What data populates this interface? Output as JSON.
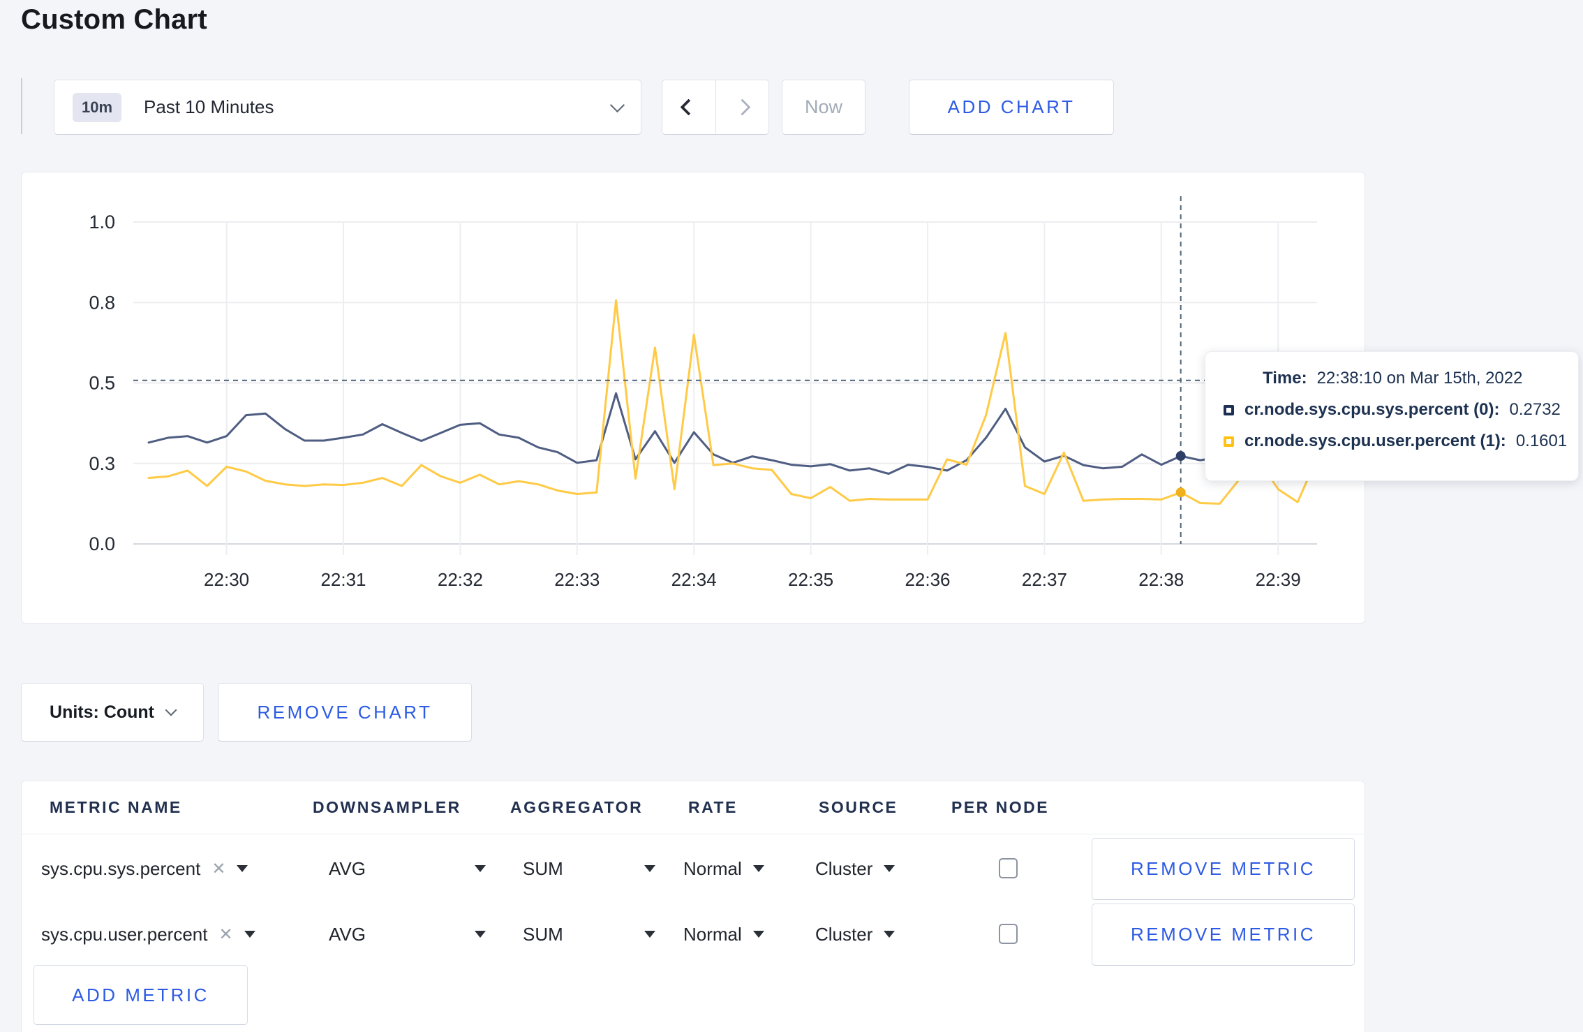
{
  "title": "Custom Chart",
  "toolbar": {
    "range_badge": "10m",
    "range_label": "Past 10 Minutes",
    "now_label": "Now",
    "add_chart_label": "ADD CHART"
  },
  "units": {
    "label": "Units: Count",
    "remove_chart_label": "REMOVE CHART"
  },
  "chart_data": {
    "type": "line",
    "x_start": "22:29:20",
    "x_step_seconds": 10,
    "x_ticks": [
      "22:30",
      "22:31",
      "22:32",
      "22:33",
      "22:34",
      "22:35",
      "22:36",
      "22:37",
      "22:38",
      "22:39"
    ],
    "y_ticks": [
      "1.0",
      "0.8",
      "0.5",
      "0.3",
      "0.0"
    ],
    "ylim": [
      0,
      1
    ],
    "grid": true,
    "series": [
      {
        "name": "cr.node.sys.cpu.sys.percent",
        "color": "#4e5d81",
        "values": [
          0.315,
          0.33,
          0.335,
          0.315,
          0.335,
          0.4,
          0.405,
          0.357,
          0.321,
          0.321,
          0.33,
          0.34,
          0.372,
          0.345,
          0.32,
          0.345,
          0.37,
          0.375,
          0.34,
          0.33,
          0.3,
          0.285,
          0.252,
          0.26,
          0.468,
          0.263,
          0.35,
          0.252,
          0.347,
          0.278,
          0.252,
          0.272,
          0.26,
          0.246,
          0.241,
          0.248,
          0.228,
          0.235,
          0.218,
          0.246,
          0.239,
          0.228,
          0.26,
          0.33,
          0.42,
          0.3,
          0.256,
          0.274,
          0.245,
          0.235,
          0.24,
          0.278,
          0.246,
          0.273,
          0.26,
          0.27,
          0.285,
          0.295,
          0.295,
          0.298,
          0.3
        ]
      },
      {
        "name": "cr.node.sys.cpu.user.percent",
        "color": "#ffca45",
        "values": [
          0.205,
          0.21,
          0.228,
          0.18,
          0.24,
          0.225,
          0.196,
          0.185,
          0.18,
          0.185,
          0.183,
          0.19,
          0.205,
          0.18,
          0.245,
          0.21,
          0.19,
          0.215,
          0.185,
          0.195,
          0.185,
          0.166,
          0.155,
          0.16,
          0.757,
          0.203,
          0.61,
          0.17,
          0.65,
          0.245,
          0.25,
          0.235,
          0.23,
          0.155,
          0.142,
          0.177,
          0.134,
          0.14,
          0.138,
          0.138,
          0.138,
          0.263,
          0.246,
          0.4,
          0.655,
          0.18,
          0.155,
          0.284,
          0.134,
          0.138,
          0.14,
          0.14,
          0.138,
          0.16,
          0.127,
          0.125,
          0.2,
          0.26,
          0.17,
          0.13,
          0.267
        ]
      }
    ],
    "crosshair": {
      "index": 53,
      "hline_value": 0.508,
      "dot_values": [
        0.2732,
        0.1601
      ],
      "dot_colors": [
        "#2d3f66",
        "#efb21c"
      ]
    }
  },
  "tooltip": {
    "time_label": "Time:",
    "time_value": "22:38:10 on Mar 15th, 2022",
    "rows": [
      {
        "name": "cr.node.sys.cpu.sys.percent (0):",
        "value": "0.2732",
        "color": "#1c2f52"
      },
      {
        "name": "cr.node.sys.cpu.user.percent (1):",
        "value": "0.1601",
        "color": "#ffc212"
      }
    ]
  },
  "metrics": {
    "headers": [
      "METRIC NAME",
      "DOWNSAMPLER",
      "AGGREGATOR",
      "RATE",
      "SOURCE",
      "PER NODE"
    ],
    "rows": [
      {
        "metric": "sys.cpu.sys.percent",
        "downsampler": "AVG",
        "aggregator": "SUM",
        "rate": "Normal",
        "source": "Cluster",
        "per_node": false,
        "remove_label": "REMOVE METRIC"
      },
      {
        "metric": "sys.cpu.user.percent",
        "downsampler": "AVG",
        "aggregator": "SUM",
        "rate": "Normal",
        "source": "Cluster",
        "per_node": false,
        "remove_label": "REMOVE METRIC"
      }
    ],
    "close_glyph": "✕",
    "add_metric_label": "ADD METRIC"
  }
}
